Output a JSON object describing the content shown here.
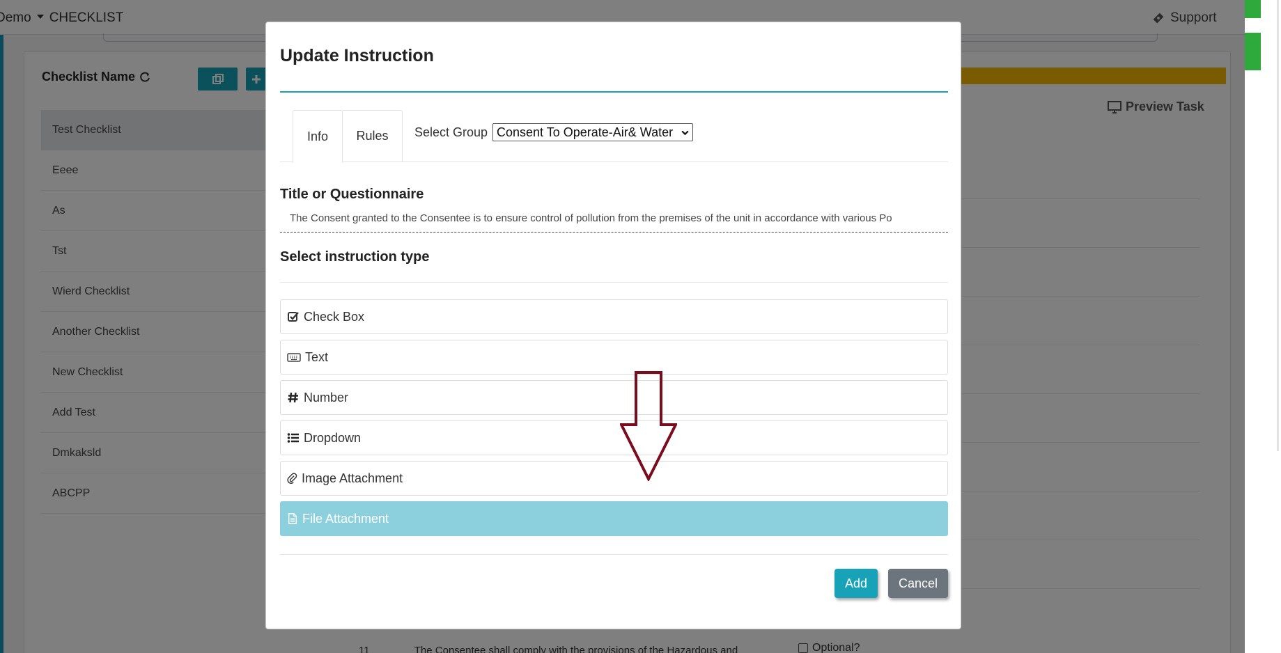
{
  "app": {
    "brand": "Demo",
    "section": "CHECKLIST",
    "support_label": "Support"
  },
  "sidebar": {
    "title": "Checklist Name",
    "items": [
      {
        "label": "Test Checklist",
        "active": true
      },
      {
        "label": "Eeee"
      },
      {
        "label": "As"
      },
      {
        "label": "Tst"
      },
      {
        "label": "Wierd Checklist"
      },
      {
        "label": "Another Checklist"
      },
      {
        "label": "New Checklist"
      },
      {
        "label": "Add Test"
      },
      {
        "label": "Dmkaksld"
      },
      {
        "label": "ABCPP"
      }
    ]
  },
  "main": {
    "preview_label": "Preview Task",
    "row_number": "11",
    "row_text": "The Consentee shall comply with the provisions of the Hazardous and",
    "optional_label": "Optional?"
  },
  "modal": {
    "title": "Update Instruction",
    "tabs": [
      {
        "label": "Info",
        "active": true
      },
      {
        "label": "Rules"
      }
    ],
    "group_label": "Select Group",
    "group_value": "Consent To Operate-Air& Water",
    "question_label": "Title or Questionnaire",
    "question_value": "The Consent granted to the Consentee is to ensure control of pollution from the premises of the unit in accordance with various Po",
    "type_label": "Select instruction type",
    "types": [
      {
        "label": "Check Box",
        "icon": "check-square-icon"
      },
      {
        "label": "Text",
        "icon": "keyboard-icon"
      },
      {
        "label": "Number",
        "icon": "hashtag-icon"
      },
      {
        "label": "Dropdown",
        "icon": "list-icon"
      },
      {
        "label": "Image Attachment",
        "icon": "paperclip-icon"
      },
      {
        "label": "File Attachment",
        "icon": "file-text-icon",
        "selected": true
      }
    ],
    "add_label": "Add",
    "cancel_label": "Cancel"
  },
  "colors": {
    "accent": "#17a2b8",
    "selected": "#8bd0dc",
    "cancel": "#6c757d",
    "annotation": "#7b0c1e",
    "highlight": "#f2b705",
    "badge": "#2eaa3c"
  }
}
